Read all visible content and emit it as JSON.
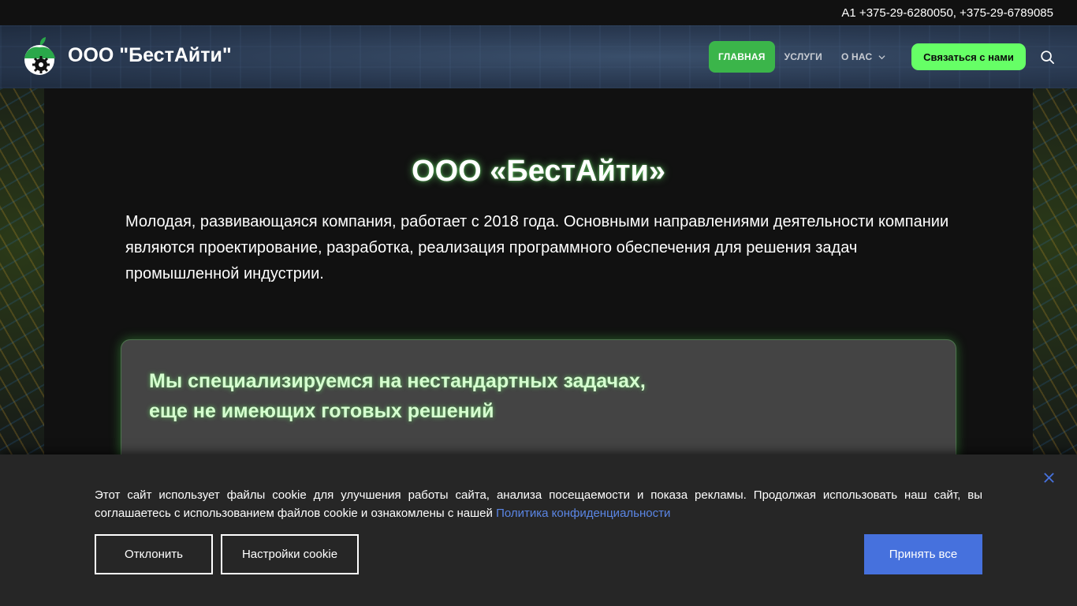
{
  "topbar": {
    "phones": "А1 +375-29-6280050, +375-29-6789085"
  },
  "header": {
    "brand": "ООО \"БестАйти\"",
    "nav": [
      {
        "label": "ГЛАВНАЯ",
        "active": true
      },
      {
        "label": "УСЛУГИ",
        "active": false
      },
      {
        "label": "О НАС",
        "active": false,
        "dropdown": true
      }
    ],
    "contact_label": "Связаться с нами",
    "colors": {
      "active_nav": "#3bb54a",
      "contact_btn": "#66ff66"
    }
  },
  "hero": {
    "title": "ООО «БестАйти»",
    "text": "Молодая, развивающаяся компания, работает с 2018 года. Основными направлениями деятельности компании являются проектирование, разработка, реализация программного обеспечения для решения задач промышленной индустрии."
  },
  "card": {
    "title_line1": "Мы специализируемся на нестандартных задачах,",
    "title_line2": "еще не имеющих готовых решений"
  },
  "cookie": {
    "text": "Этот сайт использует файлы cookie для улучшения работы сайта, анализа посещаемости и показа рекламы. Продолжая использовать наш сайт, вы соглашаетесь с использованием файлов cookie и ознакомлены с нашей ",
    "link": "Политика конфиденциальности",
    "decline_label": "Отклонить",
    "settings_label": "Настройки cookie",
    "accept_label": "Принять все",
    "accent": "#4671dd"
  }
}
